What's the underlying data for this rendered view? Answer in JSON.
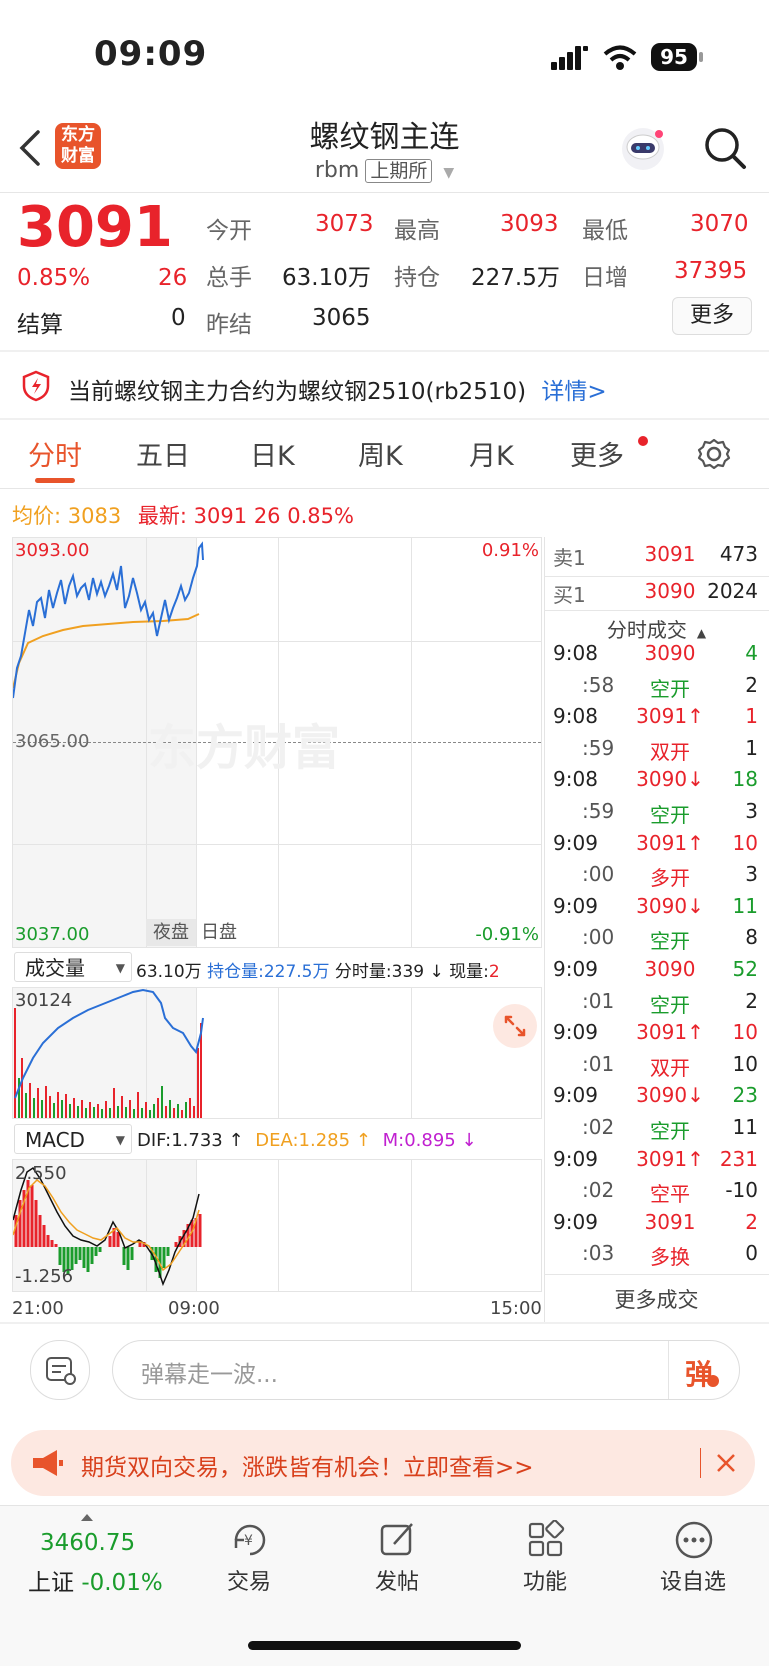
{
  "status_bar": {
    "time": "09:09",
    "battery": "95"
  },
  "header": {
    "title": "螺纹钢主连",
    "code": "rbm",
    "exchange": "上期所",
    "logo_text": "东方财富"
  },
  "quote": {
    "price": "3091",
    "change_pct": "0.85%",
    "change": "26",
    "open_label": "今开",
    "open": "3073",
    "high_label": "最高",
    "high": "3093",
    "low_label": "最低",
    "low": "3070",
    "volume_label": "总手",
    "volume": "63.10万",
    "oi_label": "持仓",
    "oi": "227.5万",
    "daily_inc_label": "日增",
    "daily_inc": "37395",
    "settle_label": "结算",
    "settle": "0",
    "prev_settle_label": "昨结",
    "prev_settle": "3065",
    "more_label": "更多"
  },
  "notice": {
    "text": "当前螺纹钢主力合约为螺纹钢2510(rb2510)",
    "link": "详情>"
  },
  "tabs": [
    "分时",
    "五日",
    "日K",
    "周K",
    "月K",
    "更多"
  ],
  "chart_info": {
    "avg_label": "均价:",
    "avg": "3083",
    "latest_label": "最新:",
    "latest": "3091",
    "change": "26",
    "change_pct": "0.85%"
  },
  "chart": {
    "y_top": "3093.00",
    "y_mid": "3065.00",
    "y_bottom": "3037.00",
    "pct_top": "0.91%",
    "pct_bottom": "-0.91%",
    "session_night": "夜盘",
    "session_day": "日盘",
    "watermark": "东方财富"
  },
  "volume_bar": {
    "selector": "成交量",
    "volume": "63.10万",
    "oi_label": "持仓量:",
    "oi": "227.5万",
    "period_label": "分时量:",
    "period": "339",
    "arrow": "↓",
    "now_label": "现量:",
    "now": "2",
    "axis_max": "30124"
  },
  "macd_bar": {
    "selector": "MACD",
    "dif": "DIF:1.733",
    "dea": "DEA:1.285",
    "m": "M:0.895",
    "axis_max": "2.550",
    "axis_min": "-1.256"
  },
  "x_axis": {
    "start": "21:00",
    "mid": "09:00",
    "end": "15:00"
  },
  "order_book": {
    "sell_label": "卖1",
    "sell_price": "3091",
    "sell_vol": "473",
    "buy_label": "买1",
    "buy_price": "3090",
    "buy_vol": "2024"
  },
  "ticks_header": "分时成交",
  "ticks": [
    {
      "time": "9:08",
      "price": "3090",
      "pclass": "red",
      "vol": "4",
      "vclass": "green"
    },
    {
      "time": ":58",
      "price": "空开",
      "pclass": "green",
      "vol": "2",
      "vclass": "dark"
    },
    {
      "time": "9:08",
      "price": "3091↑",
      "pclass": "red",
      "vol": "1",
      "vclass": "red"
    },
    {
      "time": ":59",
      "price": "双开",
      "pclass": "red",
      "vol": "1",
      "vclass": "dark"
    },
    {
      "time": "9:08",
      "price": "3090↓",
      "pclass": "red",
      "vol": "18",
      "vclass": "green"
    },
    {
      "time": ":59",
      "price": "空开",
      "pclass": "green",
      "vol": "3",
      "vclass": "dark"
    },
    {
      "time": "9:09",
      "price": "3091↑",
      "pclass": "red",
      "vol": "10",
      "vclass": "red"
    },
    {
      "time": ":00",
      "price": "多开",
      "pclass": "red",
      "vol": "3",
      "vclass": "dark"
    },
    {
      "time": "9:09",
      "price": "3090↓",
      "pclass": "red",
      "vol": "11",
      "vclass": "green"
    },
    {
      "time": ":00",
      "price": "空开",
      "pclass": "green",
      "vol": "8",
      "vclass": "dark"
    },
    {
      "time": "9:09",
      "price": "3090",
      "pclass": "red",
      "vol": "52",
      "vclass": "green"
    },
    {
      "time": ":01",
      "price": "空开",
      "pclass": "green",
      "vol": "2",
      "vclass": "dark"
    },
    {
      "time": "9:09",
      "price": "3091↑",
      "pclass": "red",
      "vol": "10",
      "vclass": "red"
    },
    {
      "time": ":01",
      "price": "双开",
      "pclass": "red",
      "vol": "10",
      "vclass": "dark"
    },
    {
      "time": "9:09",
      "price": "3090↓",
      "pclass": "red",
      "vol": "23",
      "vclass": "green"
    },
    {
      "time": ":02",
      "price": "空开",
      "pclass": "green",
      "vol": "11",
      "vclass": "dark"
    },
    {
      "time": "9:09",
      "price": "3091↑",
      "pclass": "red",
      "vol": "231",
      "vclass": "red"
    },
    {
      "time": ":02",
      "price": "空平",
      "pclass": "red",
      "vol": "-10",
      "vclass": "dark"
    },
    {
      "time": "9:09",
      "price": "3091",
      "pclass": "red",
      "vol": "2",
      "vclass": "red"
    },
    {
      "time": ":03",
      "price": "多换",
      "pclass": "red",
      "vol": "0",
      "vclass": "dark"
    }
  ],
  "more_ticks": "更多成交",
  "comment": {
    "placeholder": "弹幕走一波...",
    "send": "弹"
  },
  "banner": {
    "text": "期货双向交易，涨跌皆有机会！立即查看>>"
  },
  "tabbar": {
    "index_value": "3460.75",
    "index_name": "上证",
    "index_change": "-0.01%",
    "trade": "交易",
    "post": "发帖",
    "function": "功能",
    "watchlist": "设自选"
  }
}
